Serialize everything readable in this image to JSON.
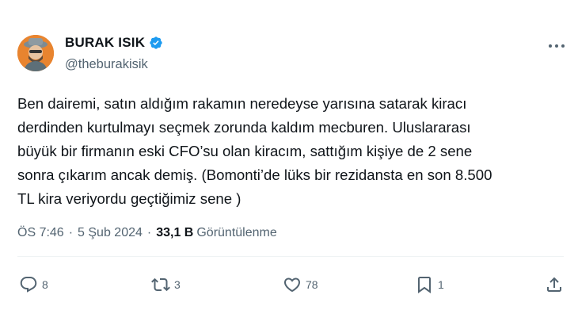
{
  "author": {
    "display_name": "BURAK ISIK",
    "handle": "@theburakisik",
    "verified_color": "#1d9bf0"
  },
  "tweet": {
    "text": "Ben dairemi, satın aldığım rakamın  neredeyse yarısına satarak kiracı\nderdinden kurtulmayı seçmek zorunda kaldım mecburen. Uluslararası\nbüyük bir firmanın eski CFO’su olan kiracım, sattığım kişiye de 2 sene\nsonra çıkarım ancak demiş. (Bomonti’de lüks bir rezidansta en son 8.500\nTL kira veriyordu geçtiğimiz sene )",
    "time": "ÖS 7:46",
    "date": "5 Şub 2024",
    "views_count": "33,1 B",
    "views_label": "Görüntülenme"
  },
  "actions": {
    "reply_count": "8",
    "retweet_count": "3",
    "like_count": "78",
    "bookmark_count": "1"
  },
  "icons": [
    "verified-badge-icon",
    "more-icon",
    "reply-icon",
    "retweet-icon",
    "like-icon",
    "bookmark-icon",
    "share-icon"
  ]
}
